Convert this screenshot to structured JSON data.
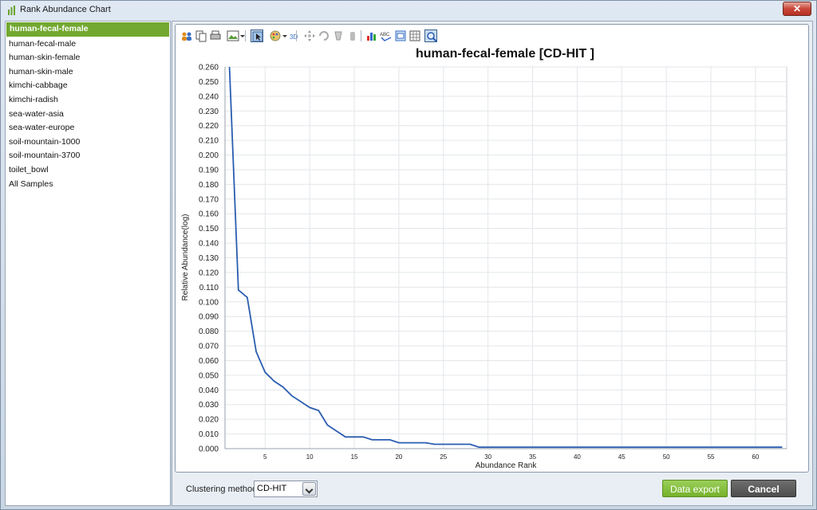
{
  "window": {
    "title": "Rank Abundance Chart",
    "close_label": "✕"
  },
  "samples": [
    "human-fecal-female",
    "human-fecal-male",
    "human-skin-female",
    "human-skin-male",
    "kimchi-cabbage",
    "kimchi-radish",
    "sea-water-asia",
    "sea-water-europe",
    "soil-mountain-1000",
    "soil-mountain-3700",
    "toilet_bowl",
    "All Samples"
  ],
  "selected_sample_index": 0,
  "toolbar": {
    "icons": [
      "people-icon",
      "copy-icon",
      "print-icon",
      "image-icon",
      "pointer-icon",
      "palette-icon",
      "3d-icon",
      "move-icon",
      "rotate-icon",
      "depth-icon",
      "hand-icon",
      "chart-style-icon",
      "abc-text-icon",
      "properties-icon",
      "grid-toggle-icon",
      "zoom-icon"
    ],
    "pressed": [
      "pointer-icon",
      "zoom-icon"
    ]
  },
  "chart_data": {
    "type": "line",
    "title": "human-fecal-female [CD-HIT ]",
    "xlabel": "Abundance Rank",
    "ylabel": "Relative Abundance(log)",
    "xlim": [
      0.5,
      63.5
    ],
    "ylim": [
      0,
      0.26
    ],
    "xticks": [
      5,
      10,
      15,
      20,
      25,
      30,
      35,
      40,
      45,
      50,
      55,
      60
    ],
    "yticks": [
      0.0,
      0.01,
      0.02,
      0.03,
      0.04,
      0.05,
      0.06,
      0.07,
      0.08,
      0.09,
      0.1,
      0.11,
      0.12,
      0.13,
      0.14,
      0.15,
      0.16,
      0.17,
      0.18,
      0.19,
      0.2,
      0.21,
      0.22,
      0.23,
      0.24,
      0.25,
      0.26
    ],
    "ytick_labels": [
      "0.000",
      "0.010",
      "0.020",
      "0.030",
      "0.040",
      "0.050",
      "0.060",
      "0.070",
      "0.080",
      "0.090",
      "0.100",
      "0.110",
      "0.120",
      "0.130",
      "0.140",
      "0.150",
      "0.160",
      "0.170",
      "0.180",
      "0.190",
      "0.200",
      "0.210",
      "0.220",
      "0.230",
      "0.240",
      "0.250",
      "0.260"
    ],
    "grid": true,
    "color": "#2a5db0",
    "x": [
      1,
      2,
      3,
      4,
      5,
      6,
      7,
      8,
      9,
      10,
      11,
      12,
      13,
      14,
      15,
      16,
      17,
      18,
      19,
      20,
      21,
      22,
      23,
      24,
      25,
      26,
      27,
      28,
      29,
      30,
      63
    ],
    "y": [
      0.26,
      0.108,
      0.103,
      0.066,
      0.052,
      0.046,
      0.042,
      0.036,
      0.032,
      0.028,
      0.026,
      0.016,
      0.012,
      0.008,
      0.008,
      0.008,
      0.006,
      0.006,
      0.006,
      0.004,
      0.004,
      0.004,
      0.004,
      0.003,
      0.003,
      0.003,
      0.003,
      0.003,
      0.001,
      0.001,
      0.001
    ]
  },
  "bottom": {
    "clustering_label": "Clustering method",
    "clustering_value": "CD-HIT",
    "export_label": "Data export",
    "cancel_label": "Cancel"
  },
  "colors": {
    "selected_bg": "#72a830",
    "export_bg": "#7fbc35",
    "cancel_bg": "#595959"
  }
}
